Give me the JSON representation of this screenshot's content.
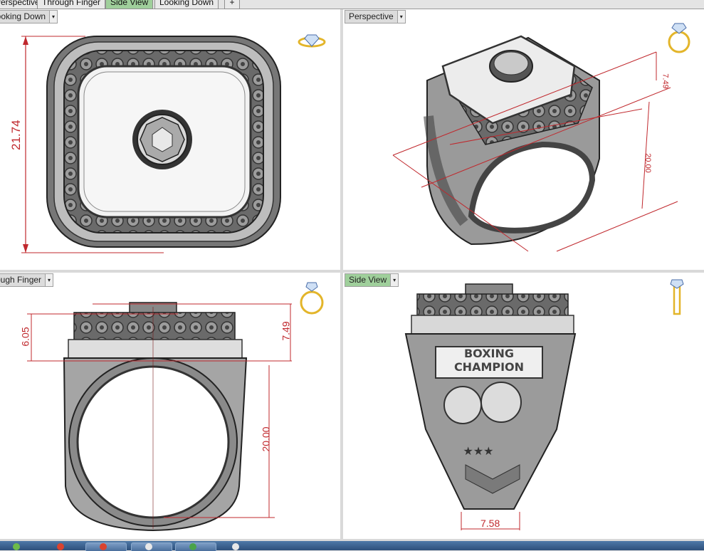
{
  "tabs": [
    {
      "label": "Perspective",
      "active": false
    },
    {
      "label": "Through Finger",
      "active": false
    },
    {
      "label": "Side View",
      "active": true
    },
    {
      "label": "Looking Down",
      "active": false
    }
  ],
  "add_tab_glyph": "+",
  "viewports": {
    "top_left": {
      "label": "Looking Down",
      "dim_height": "21.74",
      "icon": "ring-top-view-icon"
    },
    "top_right": {
      "label": "Perspective",
      "dim_a": "7.49",
      "dim_b": "20.00",
      "icon": "ring-perspective-icon"
    },
    "bottom_left": {
      "label": "Through Finger",
      "dim_left": "6.05",
      "dim_right": "7.49",
      "dim_inner": "20.00",
      "icon": "ring-front-icon"
    },
    "bottom_right": {
      "label": "Side View",
      "dim_shank": "7.58",
      "engraving_line1": "BOXING",
      "engraving_line2": "CHAMPION",
      "icon": "ring-side-icon"
    }
  },
  "dropdown_glyph": "▾",
  "colors": {
    "dimension": "#c0282d",
    "active_tab": "#9fcf9b",
    "viewport_bg": "#ffffff",
    "metal_dark": "#555555",
    "metal_light": "#e6e6e6"
  }
}
